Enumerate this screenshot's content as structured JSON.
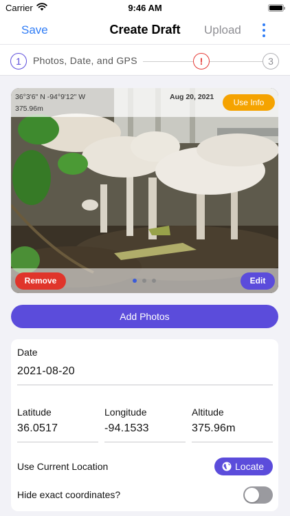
{
  "status": {
    "carrier": "Carrier",
    "time": "9:46 AM"
  },
  "nav": {
    "save_label": "Save",
    "title": "Create Draft",
    "upload_label": "Upload"
  },
  "stepper": {
    "step1_number": "1",
    "step1_label": "Photos, Date, and GPS",
    "step2_symbol": "!",
    "step3_number": "3"
  },
  "photo": {
    "gps_coords": "36°3'6\" N -94°9'12\" W",
    "gps_altitude": "375.96m",
    "date": "Aug 20, 2021",
    "use_info_label": "Use Info",
    "remove_label": "Remove",
    "edit_label": "Edit",
    "page_count": 3,
    "active_page": 1
  },
  "add_photos_label": "Add Photos",
  "form": {
    "date_label": "Date",
    "date_value": "2021-08-20",
    "latitude_label": "Latitude",
    "latitude_value": "36.0517",
    "longitude_label": "Longitude",
    "longitude_value": "-94.1533",
    "altitude_label": "Altitude",
    "altitude_value": "375.96m",
    "current_location_label": "Use Current Location",
    "locate_label": "Locate",
    "hide_coords_label": "Hide exact coordinates?",
    "hide_coords_on": false
  },
  "colors": {
    "accent": "#5b4cdb",
    "link": "#2f7cf6",
    "warning": "#e53935",
    "use_info": "#f5a300",
    "remove": "#e0352b"
  }
}
